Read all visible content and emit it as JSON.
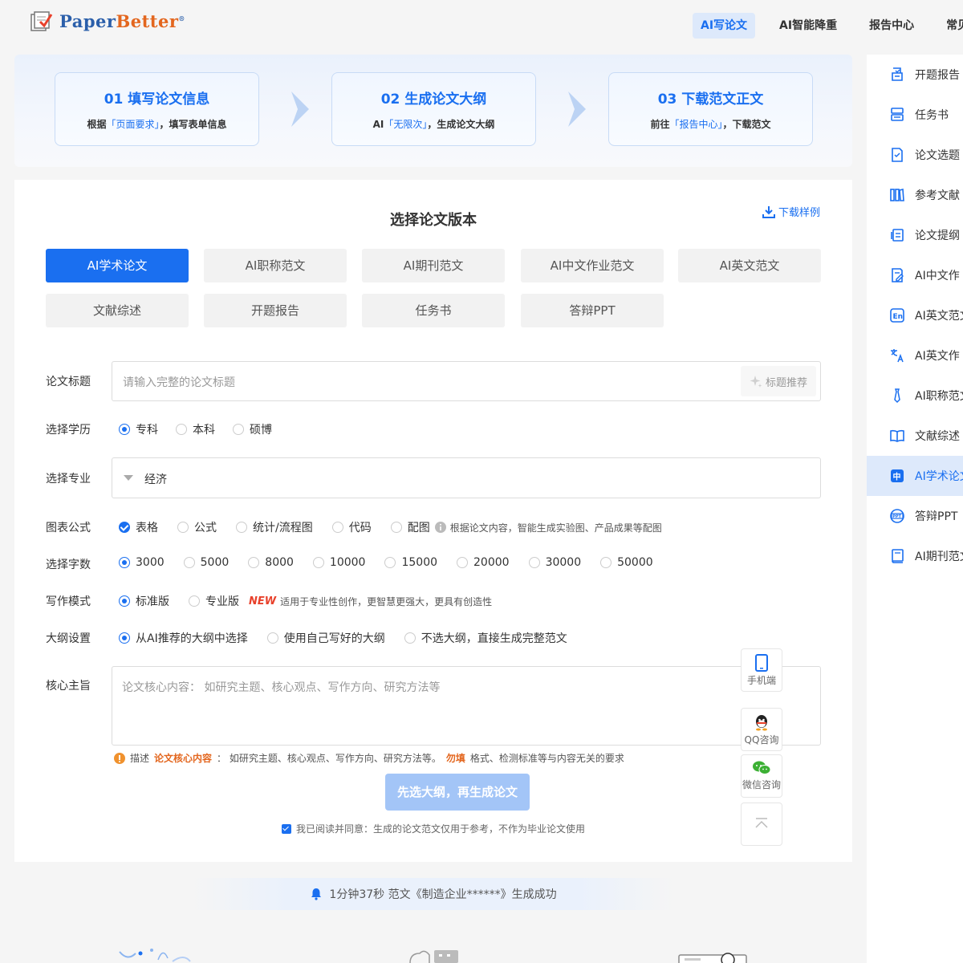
{
  "header": {
    "logo_text_a": "Paper",
    "logo_text_b": "Better",
    "logo_reg": "®",
    "nav": [
      {
        "label": "AI写论文",
        "active": true
      },
      {
        "label": "AI智能降重",
        "active": false
      },
      {
        "label": "报告中心",
        "active": false
      },
      {
        "label": "常见",
        "active": false
      }
    ]
  },
  "steps": [
    {
      "title": "01  填写论文信息",
      "desc_pre": "根据",
      "desc_hl": "「页面要求」",
      "desc_post": "，填写表单信息"
    },
    {
      "title": "02  生成论文大纲",
      "desc_pre": "AI",
      "desc_hl": "「无限次」",
      "desc_post": "，生成论文大纲"
    },
    {
      "title": "03  下载范文正文",
      "desc_pre": "前往",
      "desc_hl": "「报告中心」",
      "desc_post": "，下载范文"
    }
  ],
  "form": {
    "title": "选择论文版本",
    "download_sample": "下载样例",
    "versions": [
      "AI学术论文",
      "AI职称范文",
      "AI期刊范文",
      "AI中文作业范文",
      "AI英文范文",
      "文献综述",
      "开题报告",
      "任务书",
      "答辩PPT"
    ],
    "active_version": "AI学术论文",
    "paper_title_label": "论文标题",
    "paper_title_placeholder": "请输入完整的论文标题",
    "title_recommend": "标题推荐",
    "education_label": "选择学历",
    "education_options": [
      "专科",
      "本科",
      "硕博"
    ],
    "education_selected": "专科",
    "major_label": "选择专业",
    "major_value": "经济",
    "charts_label": "图表公式",
    "charts_options": [
      "表格",
      "公式",
      "统计/流程图",
      "代码",
      "配图"
    ],
    "charts_checked": [
      "表格"
    ],
    "charts_note": "根据论文内容，智能生成实验图、产品成果等配图",
    "words_label": "选择字数",
    "words_options": [
      "3000",
      "5000",
      "8000",
      "10000",
      "15000",
      "20000",
      "30000",
      "50000"
    ],
    "words_selected": "3000",
    "mode_label": "写作模式",
    "mode_options": [
      "标准版",
      "专业版"
    ],
    "mode_selected": "标准版",
    "mode_new": "NEW",
    "mode_note": "适用于专业性创作，更智慧更强大，更具有创造性",
    "outline_label": "大纲设置",
    "outline_options": [
      "从AI推荐的大纲中选择",
      "使用自己写好的大纲",
      "不选大纲，直接生成完整范文"
    ],
    "outline_selected": "从AI推荐的大纲中选择",
    "core_label": "核心主旨",
    "core_placeholder": "论文核心内容： 如研究主题、核心观点、写作方向、研究方法等",
    "tip_a": "描述",
    "tip_b": "论文核心内容",
    "tip_c": "： 如研究主题、核心观点、写作方向、研究方法等。",
    "tip_d": "勿填",
    "tip_e": "格式、检测标准等与内容无关的要求",
    "submit": "先选大纲，再生成论文",
    "agree": "我已阅读并同意：生成的论文范文仅用于参考，不作为毕业论文使用"
  },
  "float": [
    {
      "label": "手机端",
      "icon": "phone-icon"
    },
    {
      "label": "QQ咨询",
      "icon": "qq-icon"
    },
    {
      "label": "微信咨询",
      "icon": "wechat-icon"
    },
    {
      "label": "",
      "icon": "back-to-top-icon"
    }
  ],
  "notice": "1分钟37秒 范文《制造企业******》生成成功",
  "sidebar": [
    {
      "label": "开题报告",
      "icon": "proposal-icon"
    },
    {
      "label": "任务书",
      "icon": "taskbook-icon"
    },
    {
      "label": "论文选题",
      "icon": "topic-icon"
    },
    {
      "label": "参考文献",
      "icon": "references-icon"
    },
    {
      "label": "论文提纲",
      "icon": "outline-icon"
    },
    {
      "label": "AI中文作",
      "icon": "chinese-homework-icon"
    },
    {
      "label": "AI英文范文",
      "icon": "english-essay-icon"
    },
    {
      "label": "AI英文作",
      "icon": "translate-icon"
    },
    {
      "label": "AI职称范文",
      "icon": "title-paper-icon"
    },
    {
      "label": "文献综述",
      "icon": "literature-review-icon"
    },
    {
      "label": "AI学术论文",
      "icon": "academic-paper-icon",
      "active": true
    },
    {
      "label": "答辩PPT",
      "icon": "ppt-icon"
    },
    {
      "label": "AI期刊范文",
      "icon": "journal-icon"
    }
  ],
  "colors": {
    "primary": "#1a6ff0",
    "orange": "#e3661e",
    "new": "#e8412b"
  }
}
